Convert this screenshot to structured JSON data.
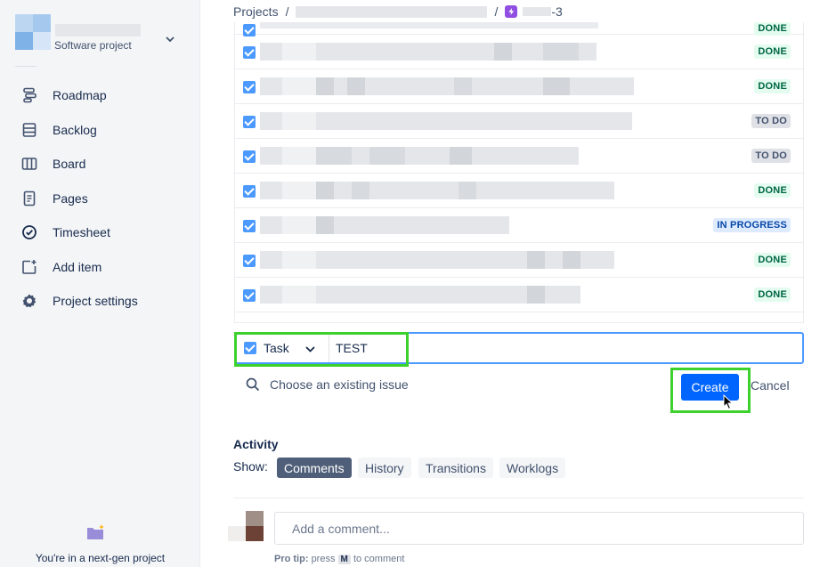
{
  "sidebar": {
    "project_type": "Software project",
    "nav": [
      {
        "label": "Roadmap",
        "icon": "roadmap-icon"
      },
      {
        "label": "Backlog",
        "icon": "backlog-icon"
      },
      {
        "label": "Board",
        "icon": "board-icon"
      },
      {
        "label": "Pages",
        "icon": "pages-icon"
      },
      {
        "label": "Timesheet",
        "icon": "timesheet-icon"
      },
      {
        "label": "Add item",
        "icon": "add-item-icon"
      },
      {
        "label": "Project settings",
        "icon": "gear-icon"
      }
    ],
    "footer_text": "You're in a next-gen project"
  },
  "breadcrumb": {
    "projects": "Projects",
    "sep": "/",
    "issue_suffix": "-3"
  },
  "child_issues": [
    {
      "status": "DONE",
      "kind": "done"
    },
    {
      "status": "DONE",
      "kind": "done"
    },
    {
      "status": "TO DO",
      "kind": "todo"
    },
    {
      "status": "TO DO",
      "kind": "todo"
    },
    {
      "status": "DONE",
      "kind": "done"
    },
    {
      "status": "IN PROGRESS",
      "kind": "prog"
    },
    {
      "status": "DONE",
      "kind": "done"
    },
    {
      "status": "DONE",
      "kind": "done"
    }
  ],
  "create_row": {
    "type_label": "Task",
    "summary_value": "TEST",
    "choose_existing": "Choose an existing issue",
    "create_label": "Create",
    "cancel_label": "Cancel"
  },
  "activity": {
    "title": "Activity",
    "show_label": "Show:",
    "filters": [
      "Comments",
      "History",
      "Transitions",
      "Worklogs"
    ],
    "comment_placeholder": "Add a comment...",
    "protip_prefix": "Pro tip:",
    "protip_press": "press",
    "protip_key": "M",
    "protip_suffix": "to comment"
  },
  "colors": {
    "primary": "#0065ff",
    "highlight": "#3cd12d",
    "done": "#006644",
    "in_progress": "#0747a6"
  }
}
